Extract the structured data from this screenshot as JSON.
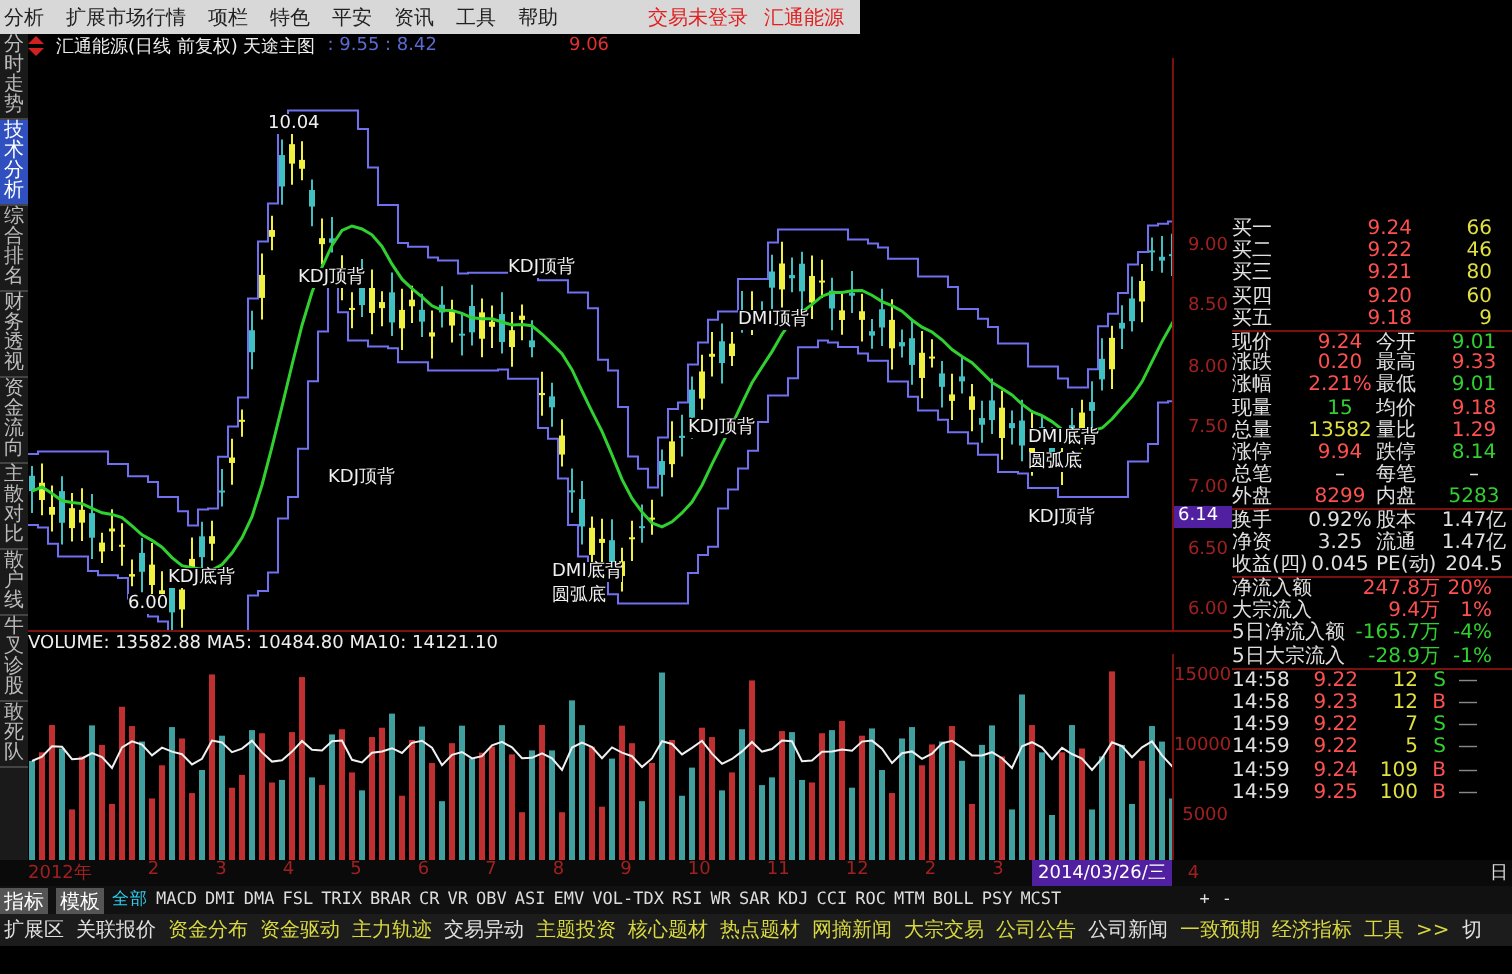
{
  "menu_bar": {
    "items": [
      "分析",
      "扩展市场行情",
      "项栏",
      "特色",
      "平安",
      "资讯",
      "工具",
      "帮助"
    ],
    "status": [
      "交易未登录",
      "汇通能源"
    ]
  },
  "side_tabs": [
    {
      "label": "分时走势",
      "selected": false
    },
    {
      "label": "技术分析",
      "selected": true
    },
    {
      "label": "综合排名",
      "selected": false
    },
    {
      "label": "财务透视",
      "selected": false
    },
    {
      "label": "资金流向",
      "selected": false
    },
    {
      "label": "主散对比",
      "selected": false
    },
    {
      "label": "散户线",
      "selected": false
    },
    {
      "label": "牛叉诊股",
      "selected": false
    },
    {
      "label": "敢死队",
      "selected": false
    }
  ],
  "chart_header": {
    "title": "汇通能源(日线 前复权) 天途主图",
    "values": ": 9.55 : 8.42",
    "last": "9.06"
  },
  "price_axis": {
    "ticks": [
      "9.00",
      "8.50",
      "8.00",
      "7.50",
      "7.00",
      "6.50",
      "6.00"
    ],
    "current": "6.14"
  },
  "chart_markers": [
    "10.04",
    "6.00",
    "KDJ顶背",
    "KDJ顶背",
    "KDJ顶背",
    "KDJ底背",
    "DMI底背",
    "圆弧底",
    "DMI顶背",
    "KDJ顶背",
    "DMI底背",
    "圆弧底",
    "KDJ顶背"
  ],
  "volume_header": "VOLUME: 13582.88  MA5: 10484.80  MA10: 14121.10",
  "volume_axis": {
    "ticks": [
      "15000",
      "10000",
      "5000"
    ]
  },
  "bids": [
    {
      "label": "买一",
      "price": "9.24",
      "volume": "66"
    },
    {
      "label": "买二",
      "price": "9.22",
      "volume": "46"
    },
    {
      "label": "买三",
      "price": "9.21",
      "volume": "80"
    },
    {
      "label": "买四",
      "price": "9.20",
      "volume": "60"
    },
    {
      "label": "买五",
      "price": "9.18",
      "volume": "9"
    }
  ],
  "stats": [
    {
      "label": "现价",
      "value": "9.24",
      "color": "#ff5050"
    },
    {
      "label": "今开",
      "value": "9.01",
      "color": "#30d030"
    },
    {
      "label": "涨跌",
      "value": "0.20",
      "color": "#ff5050"
    },
    {
      "label": "最高",
      "value": "9.33",
      "color": "#ff5050"
    },
    {
      "label": "涨幅",
      "value": "2.21%",
      "color": "#ff5050"
    },
    {
      "label": "最低",
      "value": "9.01",
      "color": "#30d030"
    },
    {
      "label": "现量",
      "value": "15",
      "color": "#30d030"
    },
    {
      "label": "均价",
      "value": "9.18",
      "color": "#ff5050"
    },
    {
      "label": "总量",
      "value": "13582",
      "color": "#e0e040"
    },
    {
      "label": "量比",
      "value": "1.29",
      "color": "#ff5050"
    },
    {
      "label": "涨停",
      "value": "9.94",
      "color": "#ff5050"
    },
    {
      "label": "跌停",
      "value": "8.14",
      "color": "#30d030"
    },
    {
      "label": "总笔",
      "value": "–",
      "color": "#e0e0e0"
    },
    {
      "label": "每笔",
      "value": "–",
      "color": "#e0e0e0"
    },
    {
      "label": "外盘",
      "value": "8299",
      "color": "#ff5050"
    },
    {
      "label": "内盘",
      "value": "5283",
      "color": "#30d030"
    },
    {
      "label": "换手",
      "value": "0.92%",
      "color": "#e0e0e0"
    },
    {
      "label": "股本",
      "value": "1.47亿",
      "color": "#e0e0e0"
    },
    {
      "label": "净资",
      "value": "3.25",
      "color": "#e0e0e0"
    },
    {
      "label": "流通",
      "value": "1.47亿",
      "color": "#e0e0e0"
    },
    {
      "label": "收益(四)",
      "value": "0.045",
      "color": "#e0e0e0"
    },
    {
      "label": "PE(动)",
      "value": "204.5",
      "color": "#e0e0e0"
    }
  ],
  "flows": [
    {
      "label": "净流入额",
      "amount": "247.8万",
      "percent": "20%",
      "color": "#ff5050"
    },
    {
      "label": "大宗流入",
      "amount": "9.4万",
      "percent": "1%",
      "color": "#ff5050"
    },
    {
      "label": "5日净流入额",
      "amount": "-165.7万",
      "percent": "-4%",
      "color": "#30d030"
    },
    {
      "label": "5日大宗流入",
      "amount": "-28.9万",
      "percent": "-1%",
      "color": "#30d030"
    }
  ],
  "trades": [
    {
      "time": "14:58",
      "price": "9.22",
      "volume": "12",
      "side": "S",
      "mark": "—"
    },
    {
      "time": "14:58",
      "price": "9.23",
      "volume": "12",
      "side": "B",
      "mark": "—"
    },
    {
      "time": "14:59",
      "price": "9.22",
      "volume": "7",
      "side": "S",
      "mark": "—"
    },
    {
      "time": "14:59",
      "price": "9.22",
      "volume": "5",
      "side": "S",
      "mark": "—"
    },
    {
      "time": "14:59",
      "price": "9.24",
      "volume": "109",
      "side": "B",
      "mark": "—"
    },
    {
      "time": "14:59",
      "price": "9.25",
      "volume": "100",
      "side": "B",
      "mark": "—"
    }
  ],
  "date_axis": {
    "labels": [
      "2012年",
      "2",
      "3",
      "4",
      "5",
      "6",
      "7",
      "8",
      "9",
      "10",
      "11",
      "12",
      "2",
      "3"
    ],
    "cursor_date": "2014/03/26/三",
    "trailing": "4",
    "right_label": "日"
  },
  "indicator_bar": {
    "buttons": [
      "指标",
      "模板"
    ],
    "tabs": [
      {
        "label": "全部",
        "selected": true
      },
      {
        "label": "MACD",
        "selected": false
      },
      {
        "label": "DMI",
        "selected": false
      },
      {
        "label": "DMA",
        "selected": false
      },
      {
        "label": "FSL",
        "selected": false
      },
      {
        "label": "TRIX",
        "selected": false
      },
      {
        "label": "BRAR",
        "selected": false
      },
      {
        "label": "CR",
        "selected": false
      },
      {
        "label": "VR",
        "selected": false
      },
      {
        "label": "OBV",
        "selected": false
      },
      {
        "label": "ASI",
        "selected": false
      },
      {
        "label": "EMV",
        "selected": false
      },
      {
        "label": "VOL-TDX",
        "selected": false
      },
      {
        "label": "RSI",
        "selected": false
      },
      {
        "label": "WR",
        "selected": false
      },
      {
        "label": "SAR",
        "selected": false
      },
      {
        "label": "KDJ",
        "selected": false
      },
      {
        "label": "CCI",
        "selected": false
      },
      {
        "label": "ROC",
        "selected": false
      },
      {
        "label": "MTM",
        "selected": false
      },
      {
        "label": "BOLL",
        "selected": false
      },
      {
        "label": "PSY",
        "selected": false
      },
      {
        "label": "MCST",
        "selected": false
      }
    ],
    "zoom": [
      "+",
      "-"
    ]
  },
  "function_bar": [
    {
      "label": "扩展区",
      "color": "#e0e0e0"
    },
    {
      "label": "关联报价",
      "color": "#e0e0e0"
    },
    {
      "label": "资金分布",
      "color": "#d8d840"
    },
    {
      "label": "资金驱动",
      "color": "#d8d840"
    },
    {
      "label": "主力轨迹",
      "color": "#d8d840"
    },
    {
      "label": "交易异动",
      "color": "#e0e0e0"
    },
    {
      "label": "主题投资",
      "color": "#d8d840"
    },
    {
      "label": "核心题材",
      "color": "#d8d840"
    },
    {
      "label": "热点题材",
      "color": "#d8d840"
    },
    {
      "label": "网摘新闻",
      "color": "#d8d840"
    },
    {
      "label": "大宗交易",
      "color": "#d8d840"
    },
    {
      "label": "公司公告",
      "color": "#d8d840"
    },
    {
      "label": "公司新闻",
      "color": "#e0e0e0"
    },
    {
      "label": "一致预期",
      "color": "#d8d840"
    },
    {
      "label": "经济指标",
      "color": "#d8d840"
    },
    {
      "label": "工具",
      "color": "#d8d840"
    },
    {
      "label": ">>",
      "color": "#d8d840"
    },
    {
      "label": "切",
      "color": "#e0e0e0"
    }
  ]
}
